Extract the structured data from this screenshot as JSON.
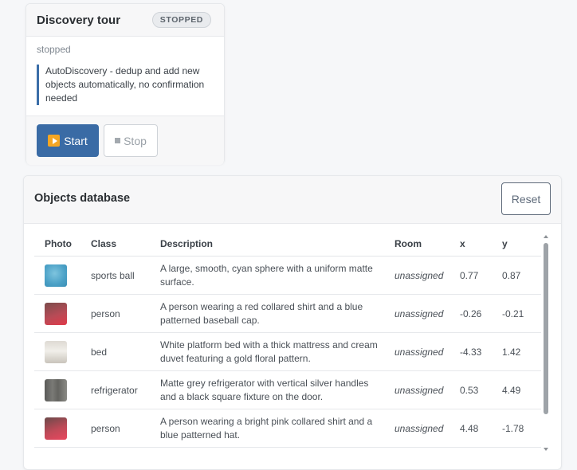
{
  "tour": {
    "title": "Discovery tour",
    "badge": "STOPPED",
    "status": "stopped",
    "note": "AutoDiscovery - dedup and add new objects automatically, no confirmation needed",
    "start_label": "Start",
    "stop_label": "Stop"
  },
  "db": {
    "title": "Objects database",
    "reset_label": "Reset",
    "columns": [
      "Photo",
      "Class",
      "Description",
      "Room",
      "x",
      "y"
    ],
    "rows": [
      {
        "class": "sports ball",
        "description": "A large, smooth, cyan sphere with a uniform matte surface.",
        "room": "unassigned",
        "x": "0.77",
        "y": "0.87"
      },
      {
        "class": "person",
        "description": "A person wearing a red collared shirt and a blue patterned baseball cap.",
        "room": "unassigned",
        "x": "-0.26",
        "y": "-0.21"
      },
      {
        "class": "bed",
        "description": "White platform bed with a thick mattress and cream duvet featuring a gold floral pattern.",
        "room": "unassigned",
        "x": "-4.33",
        "y": "1.42"
      },
      {
        "class": "refrigerator",
        "description": "Matte grey refrigerator with vertical silver handles and a black square fixture on the door.",
        "room": "unassigned",
        "x": "0.53",
        "y": "4.49"
      },
      {
        "class": "person",
        "description": "A person wearing a bright pink collared shirt and a blue patterned hat.",
        "room": "unassigned",
        "x": "4.48",
        "y": "-1.78"
      }
    ]
  },
  "colors": {
    "primary": "#3a6ba5",
    "accent_bar": "#3b6ea8",
    "start_icon": "#f5a623"
  }
}
